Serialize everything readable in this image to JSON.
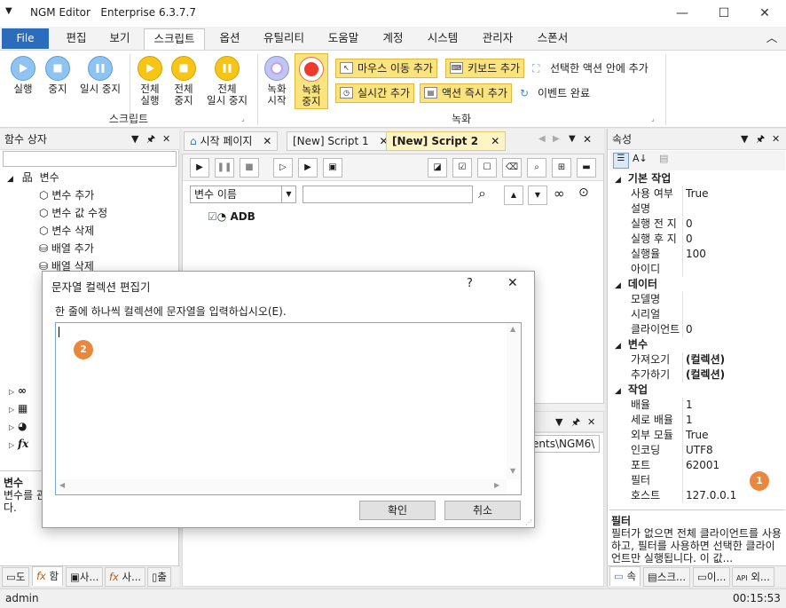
{
  "window": {
    "app": "NGM Editor",
    "edition": "Enterprise 6.3.7.7",
    "min": "—",
    "max": "☐",
    "close": "✕"
  },
  "menu": {
    "file": "File",
    "items": [
      "편집",
      "보기",
      "스크립트",
      "옵션",
      "유틸리티",
      "도움말",
      "계정",
      "시스템",
      "관리자",
      "스폰서"
    ],
    "active": "스크립트",
    "collapse": "︿"
  },
  "ribbon": {
    "script_group": {
      "label": "스크립트",
      "run": "실행",
      "stop": "중지",
      "pause": "일시 중지",
      "all_run": [
        "전체",
        "실행"
      ],
      "all_stop": [
        "전체",
        "중지"
      ],
      "all_pause": [
        "전체",
        "일시 중지"
      ]
    },
    "record_group": {
      "label": "녹화",
      "rec_start": [
        "녹화",
        "시작"
      ],
      "rec_stop": [
        "녹화",
        "중지"
      ],
      "mouse_move": "마우스 이동 추가",
      "keyboard": "키보드 추가",
      "action_in_selected": "선택한 액션 안에 추가",
      "realtime": "실시간 추가",
      "action_instant": "액션 즉시 추가",
      "event_done": "이벤트 완료"
    }
  },
  "left_panel": {
    "title": "함수 상자",
    "root": "변수",
    "items": [
      "변수 추가",
      "변수 값 수정",
      "변수 삭제",
      "배열 추가",
      "배열 삭제"
    ],
    "desc_title": "변수",
    "desc_text": "변수를 관\n다.",
    "bottom_tabs": [
      "도",
      "함",
      "사...",
      "사...",
      "출"
    ]
  },
  "doc_tabs": [
    {
      "label": "시작 페이지",
      "active": false
    },
    {
      "label": "[New] Script 1",
      "active": false
    },
    {
      "label": "[New] Script 2",
      "active": true
    }
  ],
  "script": {
    "var_select": "변수 이름",
    "search_value": "",
    "action_label": "ADB",
    "bottom_path": "ents\\NGM6\\"
  },
  "right_panel": {
    "title": "속성",
    "sections": [
      {
        "name": "기본 작업",
        "rows": [
          [
            "사용 여부",
            "True"
          ],
          [
            "설명",
            ""
          ],
          [
            "실행 전 지",
            "0"
          ],
          [
            "실행 후 지",
            "0"
          ],
          [
            "실행율",
            "100"
          ],
          [
            "아이디",
            ""
          ]
        ]
      },
      {
        "name": "데이터",
        "rows": [
          [
            "모델명",
            ""
          ],
          [
            "시리얼",
            ""
          ],
          [
            "클라이언트",
            "0"
          ]
        ]
      },
      {
        "name": "변수",
        "rows": [
          [
            "가져오기",
            "(컬렉션)"
          ],
          [
            "추가하기",
            "(컬렉션)"
          ]
        ]
      },
      {
        "name": "작업",
        "rows": [
          [
            "배율",
            "1"
          ],
          [
            "세로 배율",
            "1"
          ],
          [
            "외부 모듈",
            "True"
          ],
          [
            "인코딩",
            "UTF8"
          ],
          [
            "포트",
            "62001"
          ],
          [
            "필터",
            ""
          ],
          [
            "호스트",
            "127.0.0.1"
          ]
        ]
      }
    ],
    "desc_title": "필터",
    "desc_text": "필터가 없으면 전체 클라이언트를 사용하고, 필터를 사용하면 선택한 클라이언트만 실행됩니다. 이 값...",
    "bottom_tabs": [
      "속",
      "스크...",
      "이...",
      "외..."
    ],
    "badge": "1"
  },
  "dialog": {
    "title": "문자열 컬렉션 편집기",
    "help": "?",
    "close": "✕",
    "instruction": "한 줄에 하나씩 컬렉션에 문자열을 입력하십시오(E).",
    "text": "",
    "ok": "확인",
    "cancel": "취소",
    "badge": "2"
  },
  "status": {
    "user": "admin",
    "time": "00:15:53"
  },
  "colors": {
    "accent": "#2b6cbd",
    "ribbon_yellow": "#fbe47e",
    "badge": "#e9873c",
    "active_tab": "#fff4c4"
  }
}
